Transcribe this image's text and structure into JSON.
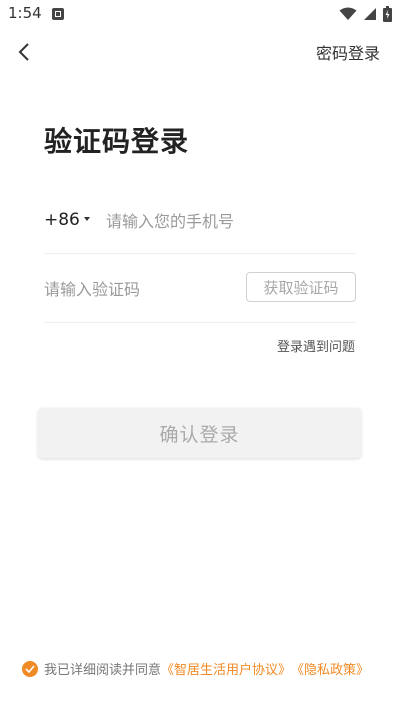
{
  "status_bar": {
    "time": "1:54"
  },
  "header": {
    "switch_label": "密码登录"
  },
  "page": {
    "title": "验证码登录"
  },
  "phone": {
    "country_code": "+86",
    "placeholder": "请输入您的手机号",
    "value": ""
  },
  "code": {
    "placeholder": "请输入验证码",
    "value": "",
    "get_code_label": "获取验证码"
  },
  "help": {
    "label": "登录遇到问题"
  },
  "confirm": {
    "label": "确认登录"
  },
  "agreement": {
    "checked": true,
    "text": "我已详细阅读并同意",
    "user_agreement": "《智居生活用户协议》",
    "privacy_policy": "《隐私政策》"
  },
  "colors": {
    "accent": "#f08a24",
    "button_bg": "#f2f2f2",
    "placeholder": "#9a9a9a"
  }
}
